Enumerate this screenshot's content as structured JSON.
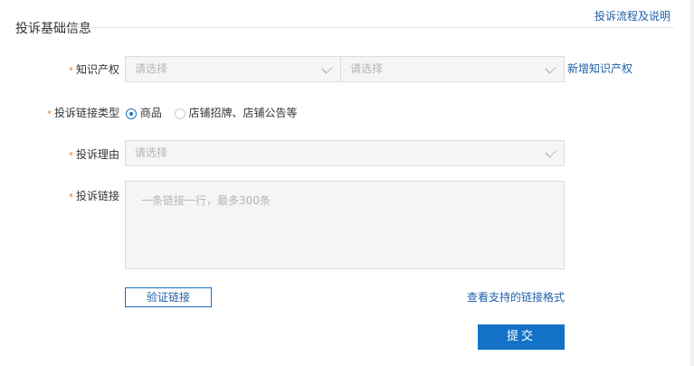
{
  "header": {
    "title": "投诉基础信息",
    "help_link": "投诉流程及说明"
  },
  "form": {
    "ip": {
      "label": "知识产权",
      "select1_placeholder": "请选择",
      "select2_placeholder": "请选择",
      "add_link": "新增知识产权"
    },
    "link_type": {
      "label": "投诉链接类型",
      "options": [
        {
          "label": "商品",
          "selected": true
        },
        {
          "label": "店铺招牌、店铺公告等",
          "selected": false
        }
      ]
    },
    "reason": {
      "label": "投诉理由",
      "placeholder": "请选择"
    },
    "links": {
      "label": "投诉链接",
      "placeholder": "一条链接一行，最多300条"
    },
    "verify_button": "验证链接",
    "formats_link": "查看支持的链接格式",
    "submit_button": "提交",
    "required_mark": "*"
  },
  "colors": {
    "accent": "#1372c8",
    "link": "#1f5fa6",
    "required": "#e07b1b"
  }
}
